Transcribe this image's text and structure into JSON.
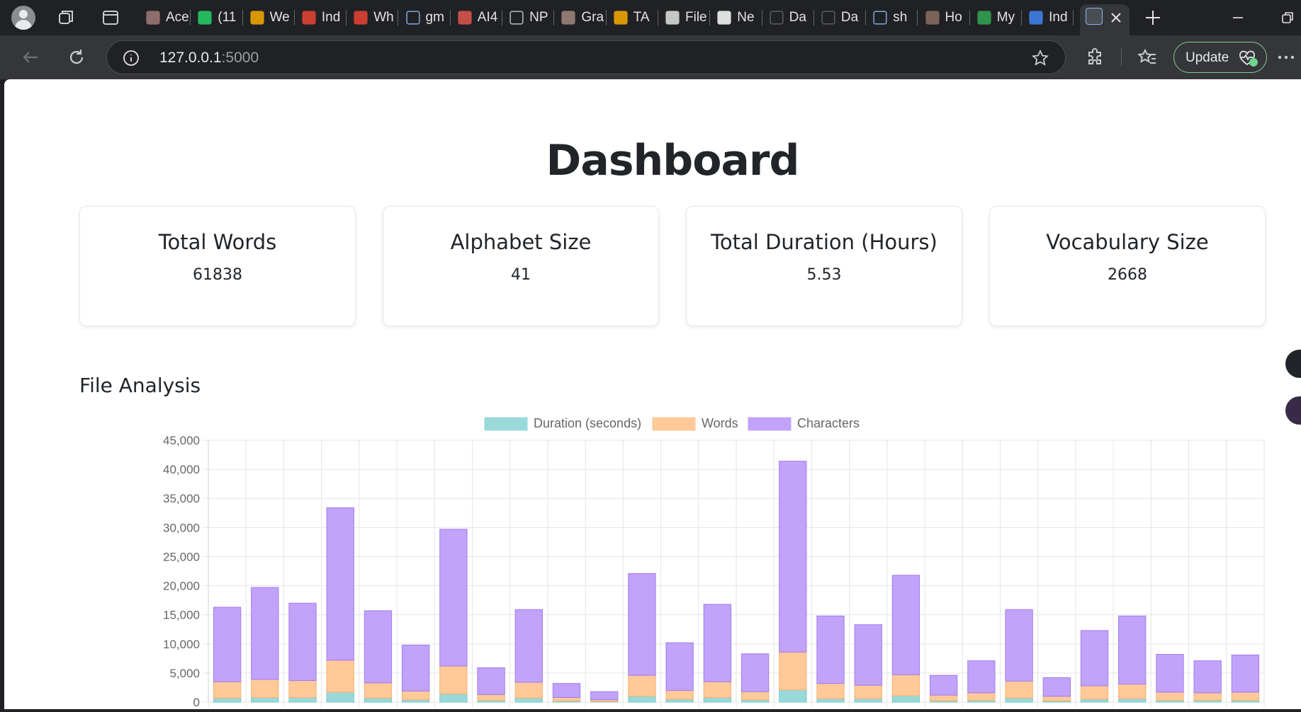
{
  "browser": {
    "tabs": [
      {
        "title": "Ace",
        "icon": "image-icon",
        "color": "#a37a7a"
      },
      {
        "title": "(11",
        "icon": "whatsapp-icon",
        "color": "#25d366"
      },
      {
        "title": "We",
        "icon": "infinity-icon",
        "color": "#f9ab00"
      },
      {
        "title": "Ind",
        "icon": "gmail-icon",
        "color": "#ea4335"
      },
      {
        "title": "Wh",
        "icon": "gmail-icon",
        "color": "#ea4335"
      },
      {
        "title": "gm",
        "icon": "search-icon",
        "color": "#8ab4f8"
      },
      {
        "title": "AI4",
        "icon": "pdf-icon",
        "color": "#e2574c"
      },
      {
        "title": "NP",
        "icon": "file-icon",
        "color": "#c9cbcf"
      },
      {
        "title": "Gra",
        "icon": "avatar-icon",
        "color": "#a1887f"
      },
      {
        "title": "TA",
        "icon": "infinity-icon",
        "color": "#f9ab00"
      },
      {
        "title": "File",
        "icon": "openai-icon",
        "color": "#e3e3e3"
      },
      {
        "title": "Ne",
        "icon": "github-icon",
        "color": "#ffffff"
      },
      {
        "title": "Da",
        "icon": "terminal-icon",
        "color": "#5f6368"
      },
      {
        "title": "Da",
        "icon": "terminal-icon",
        "color": "#5f6368"
      },
      {
        "title": "sh",
        "icon": "search-icon",
        "color": "#8ab4f8"
      },
      {
        "title": "Ho",
        "icon": "image-icon",
        "color": "#8d6e63"
      },
      {
        "title": "My",
        "icon": "drive-icon",
        "color": "#34a853"
      },
      {
        "title": "Ind",
        "icon": "calendar-icon",
        "color": "#4285f4"
      }
    ],
    "active_tab_icon": "terminal-icon",
    "url_host": "127.0.0.1",
    "url_port": ":5000",
    "update_label": "Update"
  },
  "page": {
    "title": "Dashboard",
    "cards": [
      {
        "title": "Total Words",
        "value": "61838"
      },
      {
        "title": "Alphabet Size",
        "value": "41"
      },
      {
        "title": "Total Duration (Hours)",
        "value": "5.53"
      },
      {
        "title": "Vocabulary Size",
        "value": "2668"
      }
    ],
    "section_title": "File Analysis"
  },
  "chart_data": {
    "type": "bar",
    "stacked": true,
    "legend_position": "top",
    "grid": true,
    "ylim": [
      0,
      45000
    ],
    "yticks": [
      "45,000",
      "40,000",
      "35,000",
      "30,000",
      "25,000",
      "20,000",
      "15,000",
      "10,000",
      "5,000",
      "0"
    ],
    "series": [
      {
        "name": "Duration (seconds)",
        "color": "#9ad9d9",
        "values": [
          700,
          800,
          800,
          1700,
          700,
          400,
          1400,
          300,
          700,
          200,
          100,
          1000,
          500,
          800,
          400,
          2100,
          600,
          600,
          1100,
          200,
          300,
          700,
          200,
          500,
          600,
          300,
          300,
          300
        ]
      },
      {
        "name": "Words",
        "color": "#ffc99a",
        "values": [
          2800,
          3100,
          2900,
          5500,
          2600,
          1500,
          4800,
          1000,
          2700,
          600,
          300,
          3600,
          1500,
          2700,
          1400,
          6500,
          2600,
          2300,
          3600,
          1000,
          1300,
          2900,
          800,
          2300,
          2500,
          1400,
          1300,
          1400
        ]
      },
      {
        "name": "Characters",
        "color": "#c1a3fa",
        "values": [
          12800,
          15800,
          13300,
          26200,
          12400,
          7900,
          23500,
          4600,
          12500,
          2400,
          1400,
          17500,
          8200,
          13300,
          6500,
          32800,
          11600,
          10400,
          17100,
          3400,
          5500,
          12300,
          3200,
          9500,
          11700,
          6500,
          5500,
          6400
        ]
      }
    ]
  }
}
